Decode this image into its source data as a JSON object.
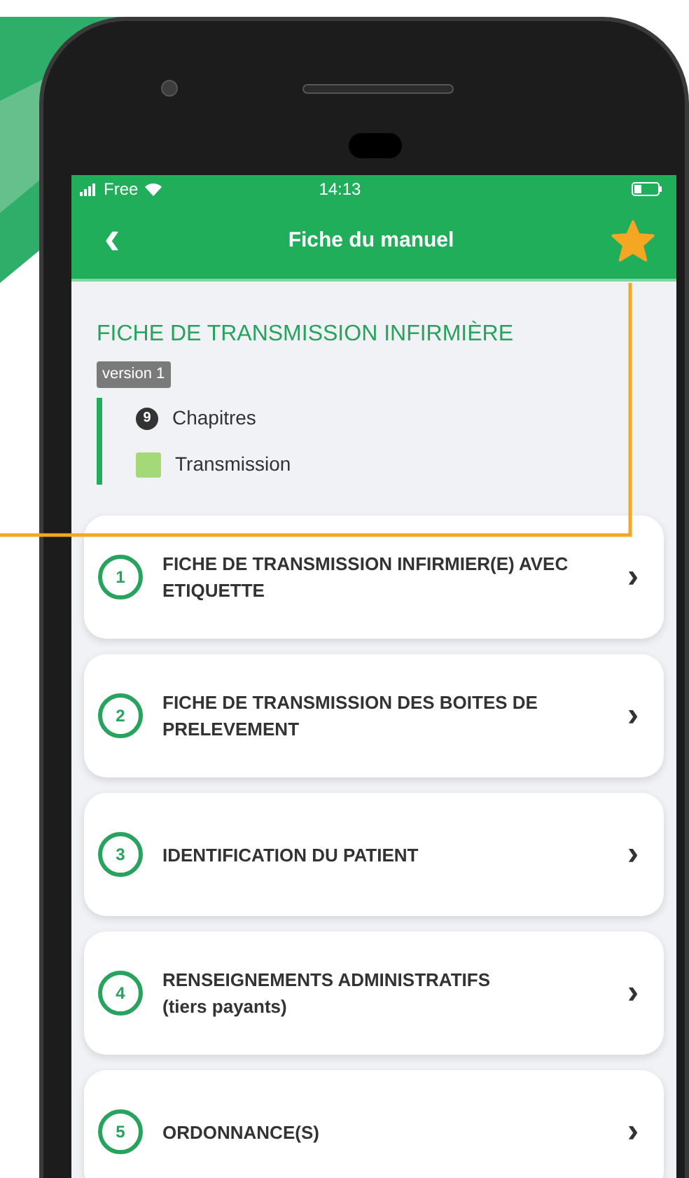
{
  "status_bar": {
    "carrier": "Free",
    "time": "14:13"
  },
  "header": {
    "back": "‹",
    "title": "Fiche du manuel",
    "favorite": true
  },
  "manual": {
    "title": "FICHE DE TRANSMISSION INFIRMIÈRE",
    "version": "version 1",
    "stats": [
      {
        "kind": "count",
        "value": "9",
        "label": "Chapitres"
      },
      {
        "kind": "swatch",
        "color": "#a3d977",
        "label": "Transmission"
      }
    ]
  },
  "chapters": [
    {
      "number": "1",
      "title": "FICHE DE TRANSMISSION INFIRMIER(E) AVEC ETIQUETTE",
      "chevron": "›"
    },
    {
      "number": "2",
      "title": "FICHE DE TRANSMISSION DES BOITES DE PRELEVEMENT",
      "chevron": "›"
    },
    {
      "number": "3",
      "title": "IDENTIFICATION DU PATIENT",
      "chevron": "›"
    },
    {
      "number": "4",
      "title": "RENSEIGNEMENTS ADMINISTRATIFS",
      "subtitle": "(tiers payants)",
      "chevron": "›"
    },
    {
      "number": "5",
      "title": "ORDONNANCE(S)",
      "chevron": "›"
    }
  ]
}
